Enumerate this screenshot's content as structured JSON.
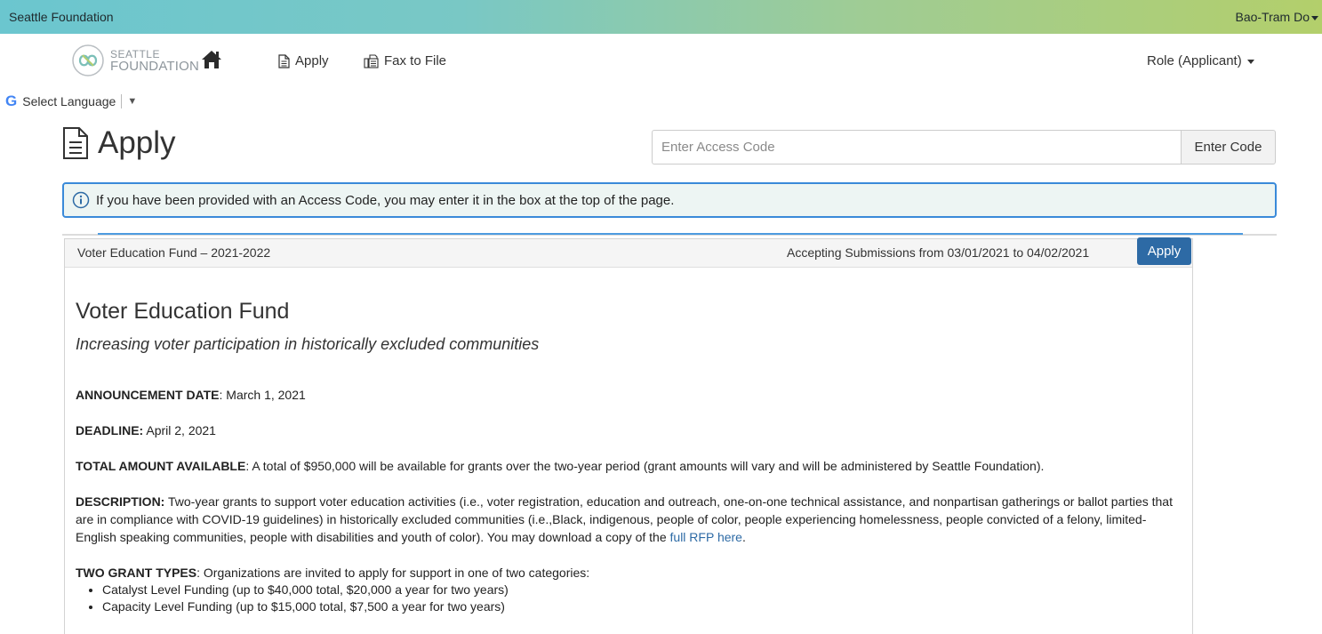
{
  "topbar": {
    "org_name": "Seattle Foundation",
    "user_name": "Bao-Tram Do"
  },
  "nav": {
    "logo_line1": "SEATTLE",
    "logo_line2": "FOUNDATION",
    "apply_label": "Apply",
    "fax_label": "Fax to File",
    "role_label": "Role (Applicant)"
  },
  "translate": {
    "label": "Select Language",
    "arrow": "▼"
  },
  "page": {
    "title": "Apply",
    "access_placeholder": "Enter Access Code",
    "access_button": "Enter Code",
    "info_text": "If you have been provided with an Access Code, you may enter it in the box at the top of the page."
  },
  "opportunity": {
    "name": "Voter Education Fund – 2021-2022",
    "submission_window": "Accepting Submissions from 03/01/2021 to 04/02/2021",
    "apply_button": "Apply",
    "heading": "Voter Education Fund",
    "subheading": "Increasing voter participation in historically excluded communities",
    "announcement_label": "ANNOUNCEMENT DATE",
    "announcement_value": ": March 1, 2021",
    "deadline_label": "DEADLINE:",
    "deadline_value": " April 2, 2021",
    "total_label": "TOTAL AMOUNT AVAILABLE",
    "total_value": ": A total of $950,000 will be available for grants over the two-year period (grant amounts will vary and will be administered by Seattle Foundation).",
    "description_label": "DESCRIPTION:",
    "description_value": " Two-year grants to support voter education activities (i.e., voter registration, education and outreach, one-on-one technical assistance, and nonpartisan gatherings or ballot parties that are in compliance with COVID-19 guidelines) in historically excluded communities (i.e.,Black, indigenous, people of color, people experiencing homelessness, people convicted of a felony, limited-English speaking communities, people with disabilities and youth of color). You may download a copy of the ",
    "description_link": "full RFP here",
    "description_end": ".",
    "grant_types_label": "TWO GRANT TYPES",
    "grant_types_value": ": Organizations are invited to apply for support in one of two categories:",
    "grant_types": [
      "Catalyst Level Funding (up to $40,000 total, $20,000 a year for two years)",
      "Capacity Level Funding (up to $15,000 total, $7,500 a year for two years)"
    ]
  },
  "colors": {
    "primary": "#2d6aa5",
    "info_border": "#3a8ad9",
    "topbar_start": "#6bc6cf",
    "topbar_end": "#b3cf6b"
  }
}
